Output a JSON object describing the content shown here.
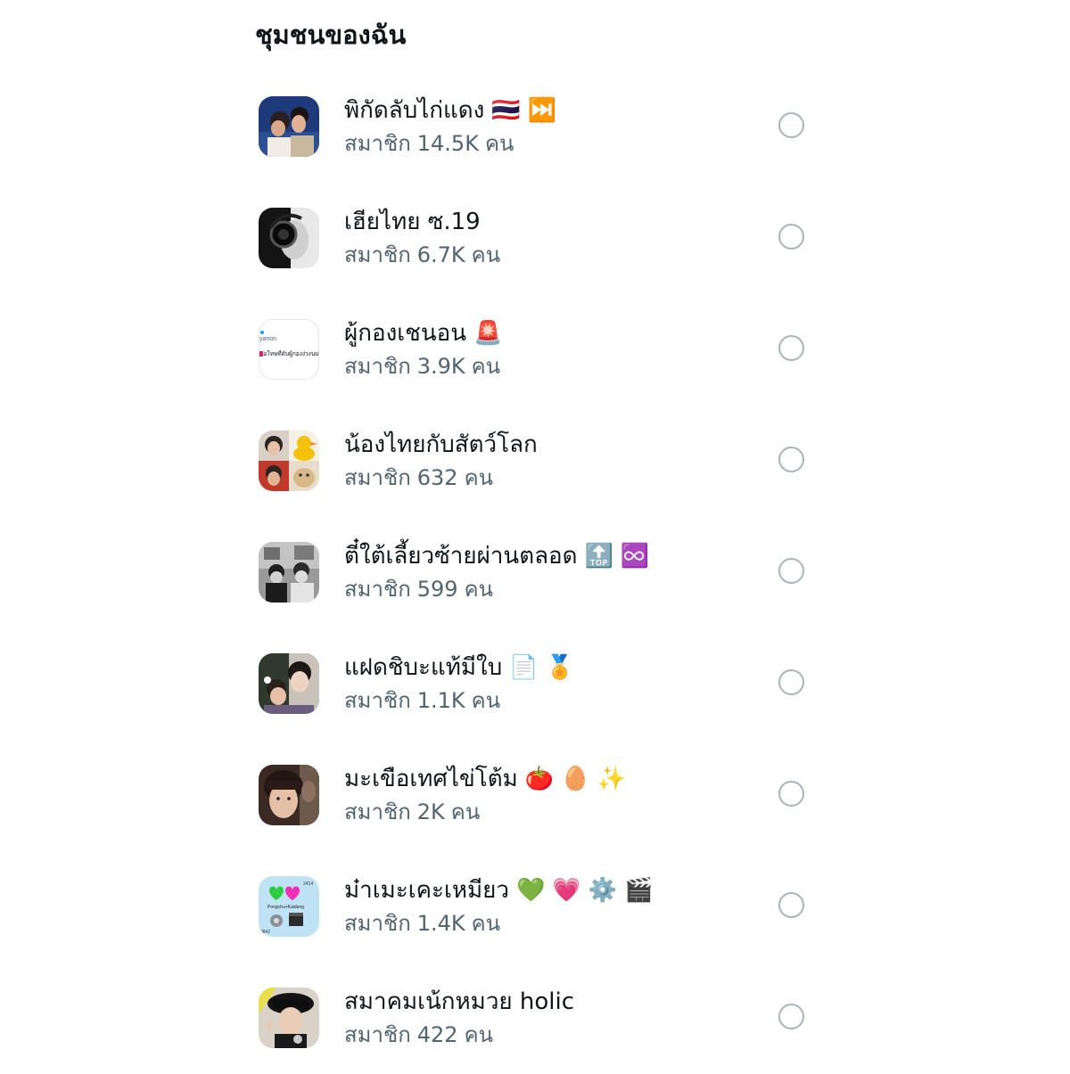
{
  "heading": "ชุมชนของฉัน",
  "communities": [
    {
      "name": "พิกัดลับไก่แดง",
      "emojis": [
        "🇹🇭",
        "⏭️"
      ],
      "members_label": "สมาชิก",
      "count": "14.5K",
      "unit": "คน",
      "avatar_icon": "two-people-photo"
    },
    {
      "name": "เฮียไทย ซ.19",
      "emojis": [],
      "members_label": "สมาชิก",
      "count": "6.7K",
      "unit": "คน",
      "avatar_icon": "headphones-bw-photo"
    },
    {
      "name": "ผู้กองเชนอน",
      "emojis": [
        "🚨"
      ],
      "members_label": "สมาชิก",
      "count": "3.9K",
      "unit": "คน",
      "avatar_icon": "text-screenshot"
    },
    {
      "name": "น้องไทยกับสัตว์โลก",
      "emojis": [],
      "members_label": "สมาชิก",
      "count": "632",
      "unit": "คน",
      "avatar_icon": "photo-collage-duck"
    },
    {
      "name": "ตี๋ใต้เลี้ยวซ้ายผ่านตลอด",
      "emojis": [
        "🔝",
        "♾️"
      ],
      "members_label": "สมาชิก",
      "count": "599",
      "unit": "คน",
      "avatar_icon": "bw-group-photo"
    },
    {
      "name": "แฝดชิบะแท้มีใบ",
      "emojis": [
        "📄",
        "🏅"
      ],
      "members_label": "สมาชิก",
      "count": "1.1K",
      "unit": "คน",
      "avatar_icon": "two-faces-photo"
    },
    {
      "name": "มะเขือเทศไข่โต้ม",
      "emojis": [
        "🍅",
        "🥚",
        "✨"
      ],
      "members_label": "สมาชิก",
      "count": "2K",
      "unit": "คน",
      "avatar_icon": "portrait-photo"
    },
    {
      "name": "ม๋าเมะเคะเหมียว",
      "emojis": [
        "💚",
        "💗",
        "⚙️",
        "🎬"
      ],
      "members_label": "สมาชิก",
      "count": "1.4K",
      "unit": "คน",
      "avatar_icon": "hearts-graphic"
    },
    {
      "name": "สมาคมเน้กหมวย holic",
      "emojis": [],
      "members_label": "สมาชิก",
      "count": "422",
      "unit": "คน",
      "avatar_icon": "hat-portrait-photo"
    }
  ],
  "avatar_texts": {
    "text_screenshot_line1": "yanon",
    "text_screenshot_line2": "ขอโทษที่ดับผู้กองง่วงนน",
    "hearts_graphic_top": "2414",
    "hearts_graphic_label": "Pongchu+Kaidang",
    "hearts_graphic_bottom": "0842"
  }
}
